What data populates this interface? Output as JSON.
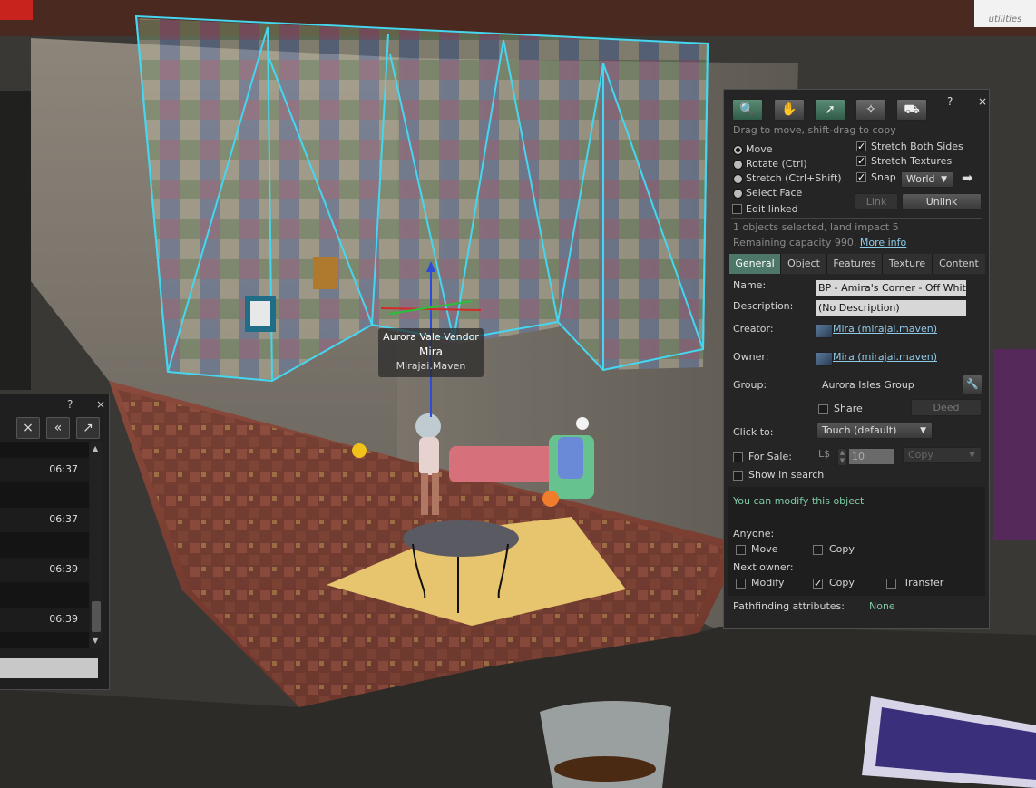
{
  "nametag": {
    "line1": "Aurora Vale Vendor",
    "line2": "Mira",
    "line3": "Mirajai.Maven"
  },
  "chat": {
    "controls": {
      "help": "?",
      "close": "×"
    },
    "toolbar": [
      "×",
      "«",
      "↗"
    ],
    "times": [
      "06:37",
      "06:37",
      "06:39",
      "06:39"
    ]
  },
  "build": {
    "controls": {
      "help": "?",
      "minimize": "–",
      "close": "×"
    },
    "hint": "Drag to move, shift-drag to copy",
    "modes": [
      {
        "label": "Move",
        "selected": true
      },
      {
        "label": "Rotate (Ctrl)",
        "selected": false
      },
      {
        "label": "Stretch (Ctrl+Shift)",
        "selected": false
      },
      {
        "label": "Select Face",
        "selected": false
      }
    ],
    "edit_linked": "Edit linked",
    "stretch_both": "Stretch Both Sides",
    "stretch_textures": "Stretch Textures",
    "snap": "Snap",
    "snap_mode": "World",
    "link_btn": "Link",
    "unlink_btn": "Unlink",
    "selection_info": "1 objects selected, land impact 5",
    "remaining": "Remaining capacity 990.",
    "more_info": "More info",
    "tabs": [
      "General",
      "Object",
      "Features",
      "Texture",
      "Content"
    ],
    "name_label": "Name:",
    "name_value": "BP - Amira's Corner - Off White",
    "desc_label": "Description:",
    "desc_value": "(No Description)",
    "creator_label": "Creator:",
    "creator_value": "Mira (mirajai.maven)",
    "owner_label": "Owner:",
    "owner_value": "Mira (mirajai.maven)",
    "group_label": "Group:",
    "group_value": "Aurora Isles Group",
    "share": "Share",
    "deed": "Deed",
    "click_to_label": "Click to:",
    "click_to_value": "Touch  (default)",
    "for_sale": "For Sale:",
    "currency": "L$",
    "price": "10",
    "sale_type": "Copy",
    "show_in_search": "Show in search",
    "modify_note": "You can modify this object",
    "anyone_label": "Anyone:",
    "anyone_move": "Move",
    "anyone_copy": "Copy",
    "next_owner_label": "Next owner:",
    "next_modify": "Modify",
    "next_copy": "Copy",
    "next_transfer": "Transfer",
    "pathfinding_label": "Pathfinding attributes:",
    "pathfinding_value": "None",
    "colors": {
      "active_tab": "#4d7768",
      "note_green": "#7ec9a4",
      "link_blue": "#8fc9e8"
    }
  }
}
